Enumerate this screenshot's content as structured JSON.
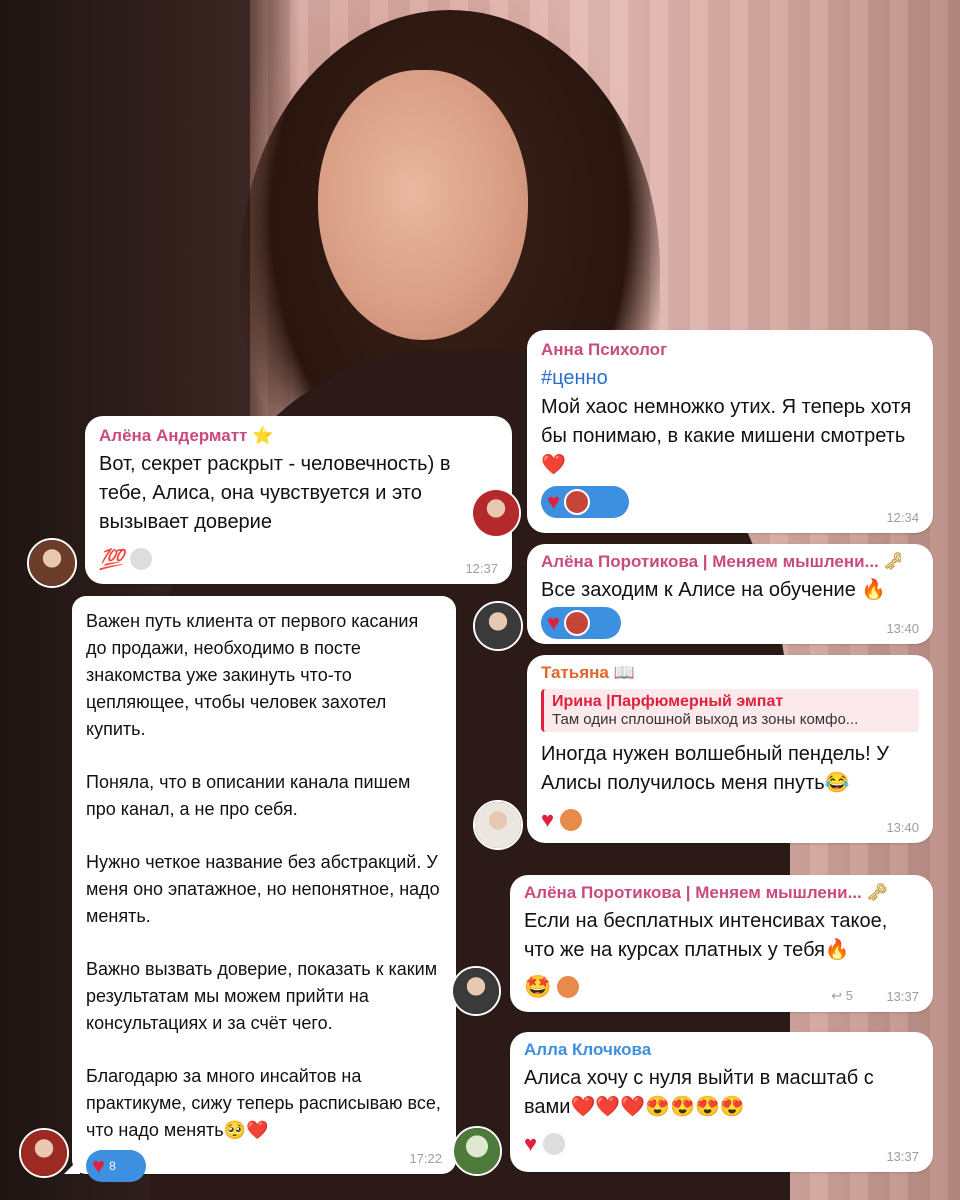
{
  "colors": {
    "pink": "#c94b7e",
    "blue": "#3d8fe0",
    "orange": "#e0662a",
    "red": "#e0203c"
  },
  "messages": [
    {
      "name": "Анна Психолог",
      "hashtag": "#ценно",
      "text": "Мой хаос немножко утих. Я теперь хотя бы понимаю, в какие мишени смотреть❤️",
      "time": "12:34"
    },
    {
      "name": "Алёна Андерматт ⭐",
      "text": "Вот, секрет раскрыт - человечность) в тебе, Алиса, она чувствуется и это вызывает доверие",
      "reaction": "💯",
      "time": "12:37"
    },
    {
      "name": "Алёна Поротикова | Меняем мышлени...",
      "text": "Все заходим к Алисе на обучение 🔥",
      "time": "13:40"
    },
    {
      "paragraphs": [
        "Важен путь клиента от первого касания до продажи, необходимо в посте знакомства уже закинуть что-то цепляющее, чтобы человек захотел купить.",
        "Поняла, что в описании канала пишем про канал, а не про себя.",
        "Нужно четкое название без абстракций. У меня оно эпатажное, но непонятное, надо менять.",
        "Важно вызвать доверие, показать к каким результатам мы можем прийти на консультациях и за счёт чего.",
        "Благодарю за много инсайтов на практикуме, сижу теперь расписываю все, что надо менять🥺❤️"
      ],
      "reaction_count": "8",
      "time": "17:22"
    },
    {
      "name": "Татьяна 📖",
      "reply_name": "Ирина |Парфюмерный эмпат",
      "reply_text": "Там один сплошной выход из зоны комфо...",
      "text": "Иногда нужен волшебный пендель! У Алисы получилось меня пнуть😂",
      "time": "13:40"
    },
    {
      "name": "Алёна Поротикова | Меняем мышлени...",
      "text": "Если на бесплатных интенсивах такое, что же на курсах платных у тебя🔥",
      "reaction": "🤩",
      "replies": "↩ 5",
      "time": "13:37"
    },
    {
      "name": "Алла Клочкова",
      "text": "Алиса хочу с нуля выйти в масштаб с вами❤️❤️❤️😍😍😍😍",
      "time": "13:37"
    }
  ],
  "icons": {
    "heart": "♥",
    "key": "🗝"
  }
}
